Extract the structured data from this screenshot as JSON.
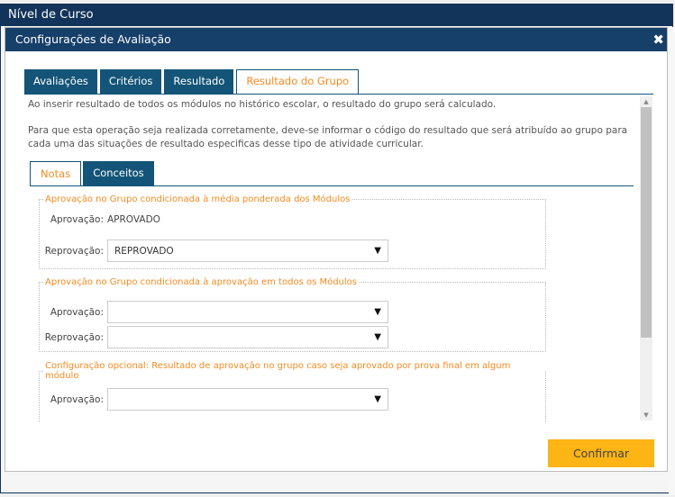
{
  "window": {
    "title": "Nível de Curso"
  },
  "dialog": {
    "title": "Configurações de Avaliação",
    "close_icon": "close-icon",
    "tabs": [
      {
        "label": "Avaliações"
      },
      {
        "label": "Critérios"
      },
      {
        "label": "Resultado"
      },
      {
        "label": "Resultado do Grupo",
        "active": true
      }
    ],
    "intro1": "Ao inserir resultado de todos os módulos no histórico escolar, o resultado do grupo será calculado.",
    "intro2": "Para que esta operação seja realizada corretamente, deve-se informar o código do resultado que será atribuído ao grupo para cada uma das situações de resultado especificas desse tipo de atividade curricular.",
    "subtabs": [
      {
        "label": "Notas",
        "active": true
      },
      {
        "label": "Conceitos"
      }
    ],
    "groups": [
      {
        "legend": "Aprovação no Grupo condicionada à média ponderada dos Módulos",
        "aprovacao_label": "Aprovação:",
        "aprovacao_value": "APROVADO",
        "reprovacao_label": "Reprovação:",
        "reprovacao_value": "REPROVADO"
      },
      {
        "legend": "Aprovação no Grupo condicionada à aprovação em todos os Módulos",
        "aprovacao_label": "Aprovação:",
        "aprovacao_value": "",
        "reprovacao_label": "Reprovação:",
        "reprovacao_value": ""
      },
      {
        "legend": "Configuração opcional: Resultado de aprovação no grupo caso seja aprovado por prova final em algum módulo",
        "aprovacao_label": "Aprovação:",
        "aprovacao_value": ""
      }
    ],
    "confirm_label": "Confirmar",
    "colors": {
      "header": "#163f69",
      "tab": "#135478",
      "accent": "#f58a1f",
      "button": "#fdb415"
    }
  }
}
